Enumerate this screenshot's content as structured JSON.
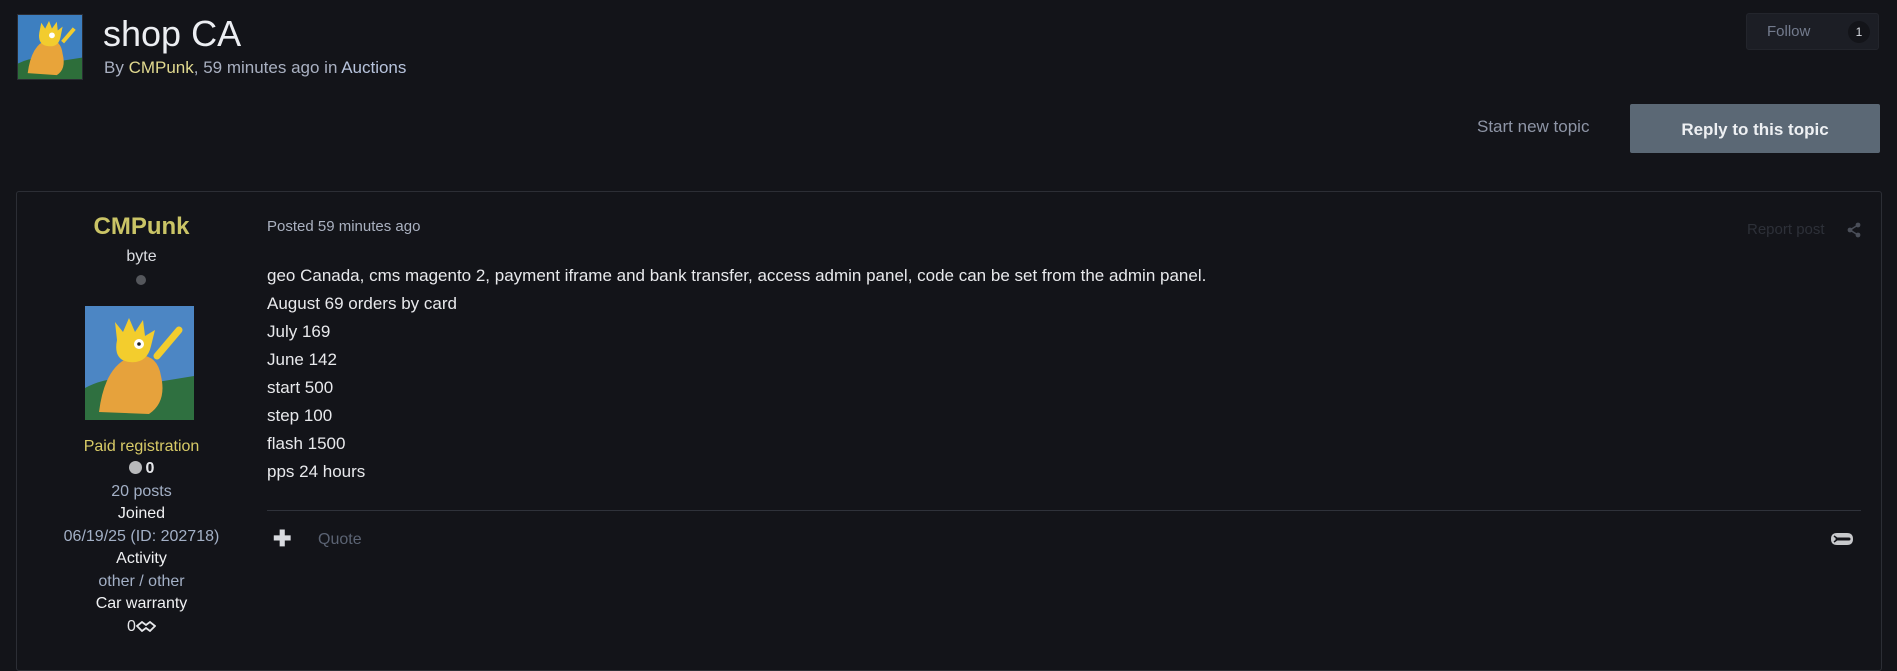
{
  "topic": {
    "title": "shop CA",
    "meta_by": "By ",
    "author": "CMPunk",
    "meta_time": ", 59 minutes ago in ",
    "forum": "Auctions"
  },
  "follow": {
    "label": "Follow",
    "count": "1"
  },
  "actions": {
    "start_new_topic": "Start new topic",
    "reply": "Reply to this topic"
  },
  "author_panel": {
    "name": "CMPunk",
    "rank": "byte",
    "group": "Paid registration",
    "reputation": "0",
    "posts": "20 posts",
    "joined_label": "Joined",
    "joined_value": "06/19/25 (ID: 202718)",
    "activity_label": "Activity",
    "activity_value": "other / other",
    "warranty_label": "Car warranty",
    "warranty_value": "0"
  },
  "post": {
    "posted": "Posted 59 minutes ago",
    "report": "Report post",
    "lines": [
      "geo Canada, cms magento 2, payment iframe and bank transfer, access admin panel, code can be set from the admin panel.",
      "August 69 orders by card",
      "July 169",
      "June 142",
      "start 500",
      "step 100",
      "flash 1500",
      "pps 24 hours"
    ],
    "plus": "✚",
    "quote": "Quote"
  },
  "icons": {
    "share": "share-icon",
    "handshake": "handshake-icon",
    "online": "online-status-icon",
    "reputation": "reputation-icon"
  },
  "colors": {
    "background": "#131419",
    "author_accent": "#cac466",
    "reply_button": "#5b6875"
  }
}
